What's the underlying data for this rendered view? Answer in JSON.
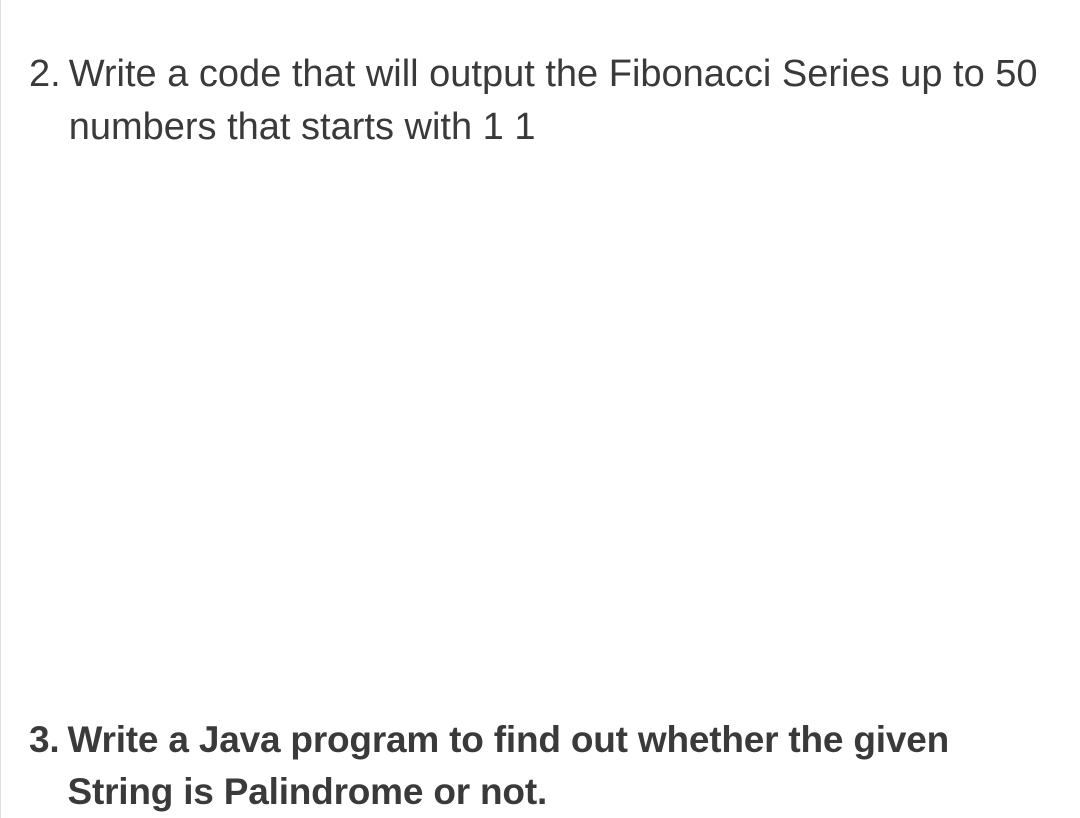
{
  "questions": [
    {
      "number": "2.",
      "text": "Write a code that will output the Fibonacci Series up to 50 numbers that starts with 1 1"
    },
    {
      "number": "3.",
      "text": "Write a Java program to find out whether the given String is Palindrome or not."
    }
  ]
}
